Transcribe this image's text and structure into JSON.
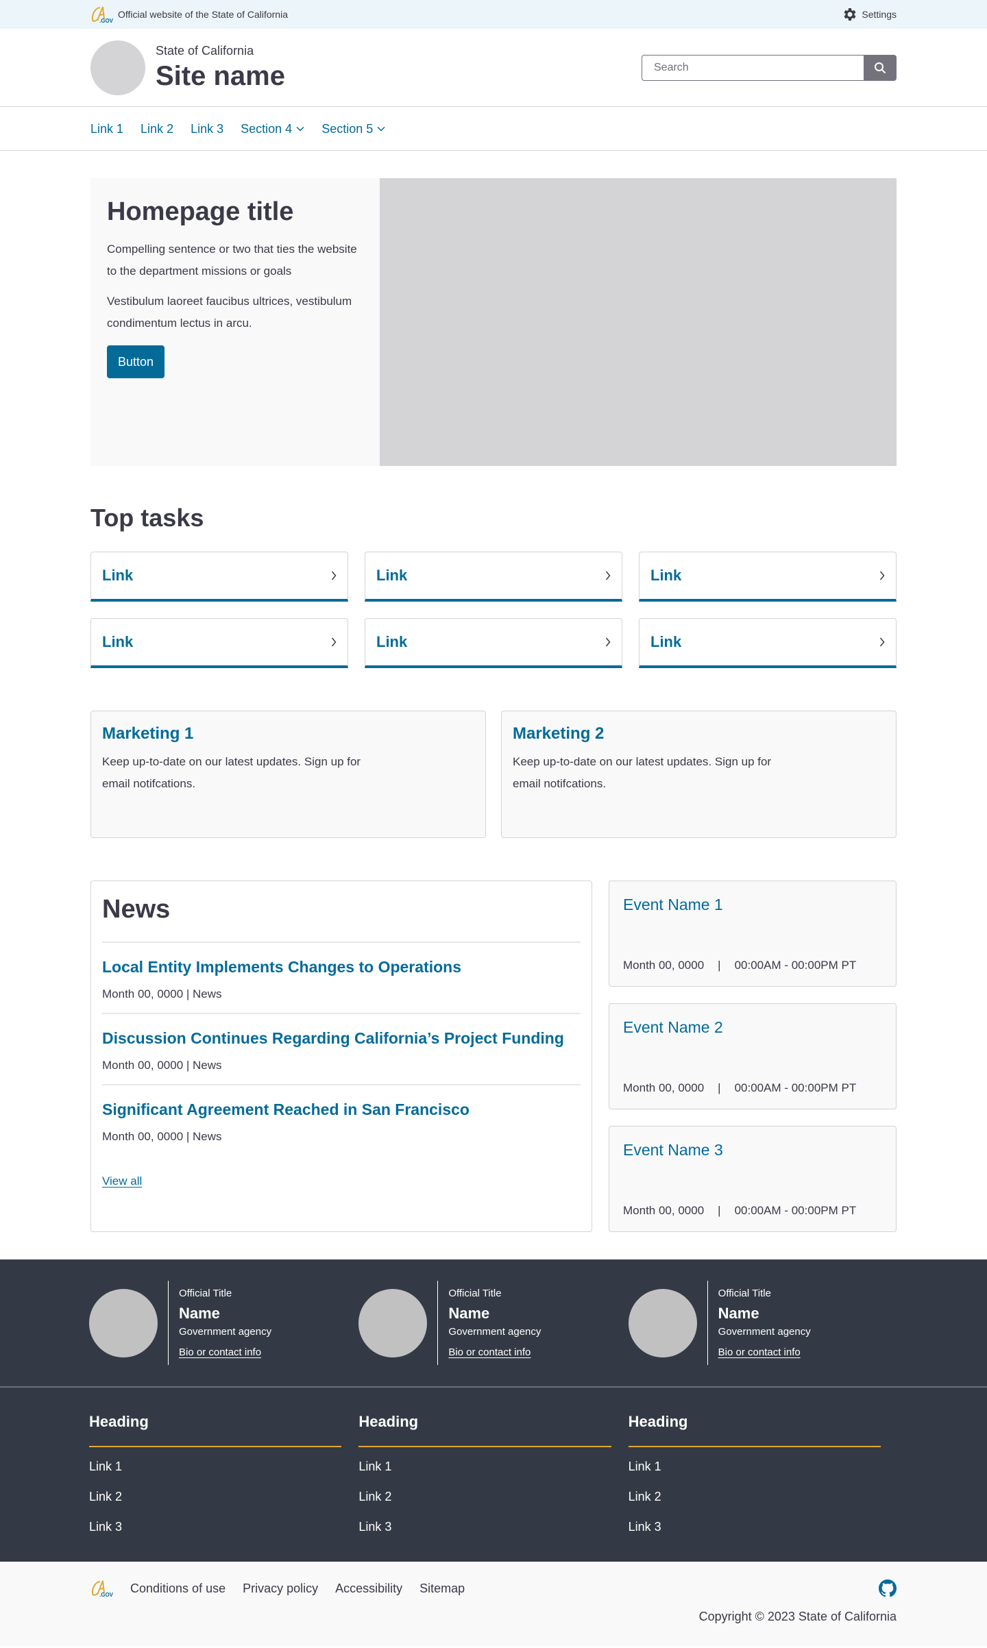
{
  "utility": {
    "official_text": "Official website of the State of California",
    "logo": "cagov-logo",
    "settings_label": "Settings",
    "settings_icon": "gear-icon"
  },
  "branding": {
    "state": "State of California",
    "site_name": "Site name",
    "search_placeholder": "Search",
    "search_value": "",
    "search_icon": "search-icon"
  },
  "nav": {
    "items": [
      {
        "label": "Link 1",
        "dropdown": false
      },
      {
        "label": "Link 2",
        "dropdown": false
      },
      {
        "label": "Link 3",
        "dropdown": false
      },
      {
        "label": "Section 4",
        "dropdown": true
      },
      {
        "label": "Section 5",
        "dropdown": true
      }
    ]
  },
  "hero": {
    "title": "Homepage title",
    "paragraphs": [
      "Compelling sentence or two that ties the website to the department missions or goals",
      "Vestibulum laoreet faucibus ultrices, vestibulum condimentum lectus in arcu."
    ],
    "button_label": "Button"
  },
  "top_tasks": {
    "title": "Top tasks",
    "items": [
      {
        "label": "Link"
      },
      {
        "label": "Link"
      },
      {
        "label": "Link"
      },
      {
        "label": "Link"
      },
      {
        "label": "Link"
      },
      {
        "label": "Link"
      }
    ]
  },
  "marketing": [
    {
      "title": "Marketing 1",
      "text": "Keep up-to-date on our latest updates. Sign up for email notifcations."
    },
    {
      "title": "Marketing 2",
      "text": "Keep up-to-date on our latest updates. Sign up for email notifcations."
    }
  ],
  "news": {
    "title": "News",
    "items": [
      {
        "headline": "Local Entity Implements Changes to Operations",
        "meta": "Month 00, 0000 | News"
      },
      {
        "headline": "Discussion Continues Regarding California’s Project Funding",
        "meta": "Month 00, 0000 | News"
      },
      {
        "headline": "Significant Agreement Reached in San Francisco",
        "meta": "Month 00, 0000 | News"
      }
    ],
    "view_all": "View all"
  },
  "events": [
    {
      "name": "Event Name 1",
      "date": "Month 00, 0000",
      "separator": "|",
      "time": "00:00AM - 00:00PM PT"
    },
    {
      "name": "Event Name 2",
      "date": "Month 00, 0000",
      "separator": "|",
      "time": "00:00AM - 00:00PM PT"
    },
    {
      "name": "Event Name 3",
      "date": "Month 00, 0000",
      "separator": "|",
      "time": "00:00AM - 00:00PM PT"
    }
  ],
  "officials": [
    {
      "title": "Official Title",
      "name": "Name",
      "agency": "Government agency",
      "link": "Bio or contact info"
    },
    {
      "title": "Official Title",
      "name": "Name",
      "agency": "Government agency",
      "link": "Bio or contact info"
    },
    {
      "title": "Official Title",
      "name": "Name",
      "agency": "Government agency",
      "link": "Bio or contact info"
    }
  ],
  "footer_columns": [
    {
      "heading": "Heading",
      "links": [
        "Link 1",
        "Link 2",
        "Link 3"
      ]
    },
    {
      "heading": "Heading",
      "links": [
        "Link 1",
        "Link 2",
        "Link 3"
      ]
    },
    {
      "heading": "Heading",
      "links": [
        "Link 1",
        "Link 2",
        "Link 3"
      ]
    }
  ],
  "bottom_footer": {
    "links": [
      "Conditions of use",
      "Privacy policy",
      "Accessibility",
      "Sitemap"
    ],
    "social_icon": "github-icon",
    "copyright": "Copyright © 2023 State of California"
  },
  "colors": {
    "primary": "#046b99",
    "text": "#3b3a48",
    "utility_bg": "#ecf5f9",
    "dark_bg": "#343a45",
    "accent_gold": "#e2a834",
    "placeholder_gray": "#d4d4d7",
    "card_bg": "#f9f9fa"
  }
}
